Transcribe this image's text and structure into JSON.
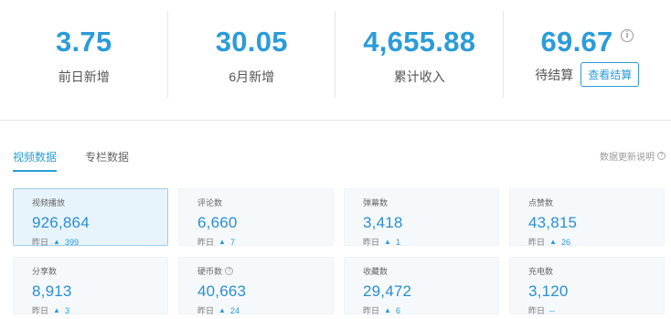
{
  "stats": [
    {
      "value": "3.75",
      "label": "前日新增"
    },
    {
      "value": "30.05",
      "label": "6月新增"
    },
    {
      "value": "4,655.88",
      "label": "累计收入"
    }
  ],
  "pending": {
    "value": "69.67",
    "label": "待结算",
    "button": "查看结算",
    "info_icon": "info-icon"
  },
  "tabs": [
    {
      "label": "视频数据",
      "active": true
    },
    {
      "label": "专栏数据",
      "active": false
    }
  ],
  "update_note": "数据更新说明",
  "yesterday_label": "昨日",
  "metrics": [
    {
      "title": "视频播放",
      "value": "926,864",
      "delta": "399"
    },
    {
      "title": "评论数",
      "value": "6,660",
      "delta": "7"
    },
    {
      "title": "弹幕数",
      "value": "3,418",
      "delta": "1"
    },
    {
      "title": "点赞数",
      "value": "43,815",
      "delta": "26"
    },
    {
      "title": "分享数",
      "value": "8,913",
      "delta": "3"
    },
    {
      "title": "硬币数",
      "value": "40,663",
      "delta": "24"
    },
    {
      "title": "收藏数",
      "value": "29,472",
      "delta": "6"
    },
    {
      "title": "充电数",
      "value": "3,120",
      "delta": "--"
    }
  ],
  "colors": {
    "accent": "#2b9cd8",
    "card_bg": "#f5f9fc",
    "active_border": "#9bd0ec"
  }
}
